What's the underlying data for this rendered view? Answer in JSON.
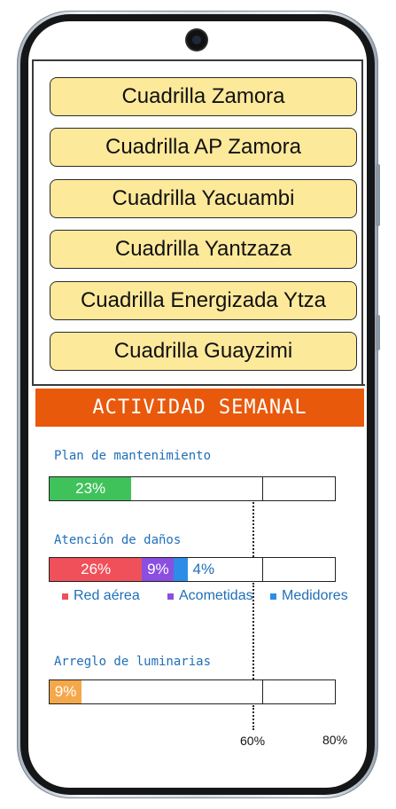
{
  "crews": [
    {
      "label": "Cuadrilla Zamora"
    },
    {
      "label": "Cuadrilla AP Zamora"
    },
    {
      "label": "Cuadrilla Yacuambi"
    },
    {
      "label": "Cuadrilla Yantzaza"
    },
    {
      "label": "Cuadrilla Energizada Ytza"
    },
    {
      "label": "Cuadrilla Guayzimi"
    }
  ],
  "activity": {
    "title": "ACTIVIDAD SEMANAL",
    "plan": {
      "label": "Plan de mantenimiento",
      "value": 23,
      "value_text": "23%",
      "color": "#3fc25a"
    },
    "damages": {
      "label": "Atención de daños",
      "segments": [
        {
          "name": "Red aérea",
          "value": 26,
          "value_text": "26%",
          "color": "#f0505a"
        },
        {
          "name": "Acometidas",
          "value": 9,
          "value_text": "9%",
          "color": "#8a4fe0"
        },
        {
          "name": "Medidores",
          "value": 4,
          "value_text": "4%",
          "color": "#2d8de6"
        }
      ]
    },
    "luminaires": {
      "label": "Arreglo de luminarias",
      "value": 9,
      "value_text": "9%",
      "color": "#f5a84a"
    },
    "axis": {
      "min": 0,
      "max": 80,
      "threshold": 60,
      "threshold_label": "60%",
      "max_label": "80%"
    }
  }
}
